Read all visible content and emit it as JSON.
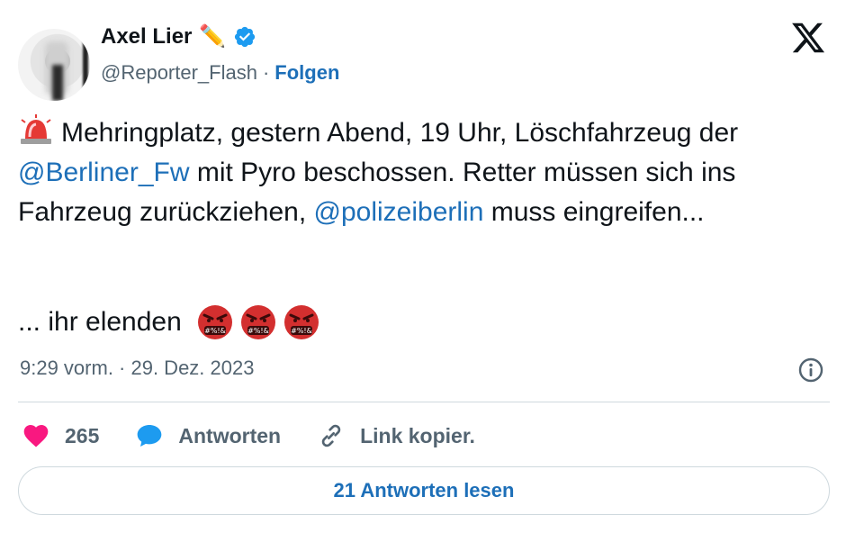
{
  "author": {
    "name": "Axel Lier",
    "name_emoji": "✏️",
    "handle": "@Reporter_Flash",
    "separator": "·",
    "follow_label": "Folgen",
    "verified_color": "#1d9bf0"
  },
  "platform_icon": "x-logo-icon",
  "tweet": {
    "segments": {
      "p1": "Mehringplatz, gestern Abend, 19 Uhr, Löschfahrzeug der ",
      "m1": "@Berliner_Fw",
      "p2": " mit Pyro beschossen. Retter müssen sich ins Fahrzeug zurückziehen, ",
      "m2": "@polizeiberlin",
      "p3": " muss eingreifen..."
    },
    "line2": "... ihr elenden",
    "leading_icon": "police-siren-icon",
    "trailing_icons": [
      "angry-face-with-symbols-icon",
      "angry-face-with-symbols-icon",
      "angry-face-with-symbols-icon"
    ]
  },
  "timestamp": "9:29 vorm. · 29. Dez. 2023",
  "actions": {
    "like_count": "265",
    "reply_label": "Antworten",
    "copy_label": "Link kopier."
  },
  "read_replies_label": "21 Antworten lesen",
  "colors": {
    "link": "#1d6fb8",
    "like": "#f91880",
    "reply": "#1d9bf0",
    "muted": "#536471",
    "border": "#cfd9de"
  }
}
